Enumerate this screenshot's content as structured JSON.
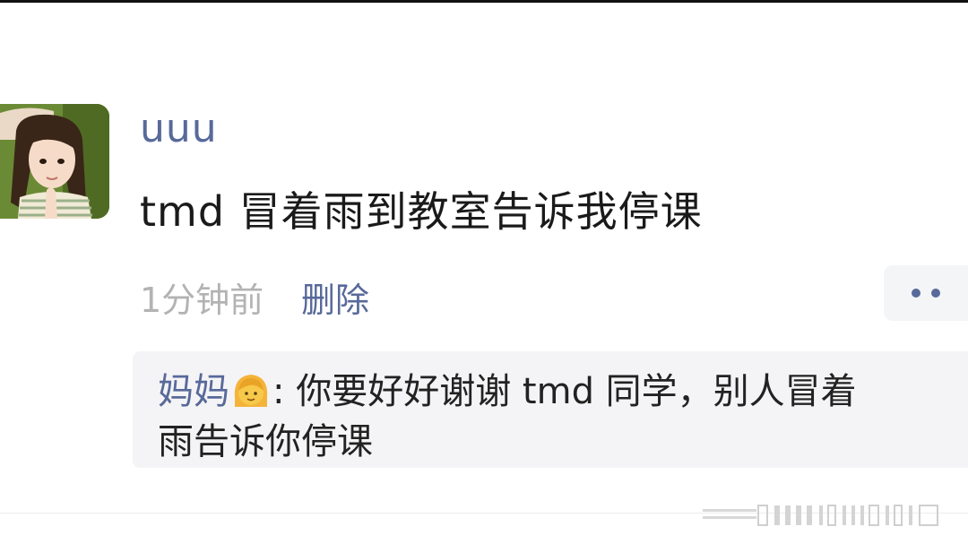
{
  "post": {
    "username": "uuu",
    "text": "tmd 冒着雨到教室告诉我停课",
    "timestamp": "1分钟前",
    "delete_label": "删除",
    "more_icon": "more-dots-icon"
  },
  "comment": {
    "author": "妈妈",
    "author_emoji": "woman-emoji-icon",
    "separator": ":",
    "text_line1": "你要好好谢谢 tmd 同学，别人冒着",
    "text_line2": "雨告诉你停课"
  },
  "colors": {
    "link": "#58699a",
    "timestamp": "#b3b3b3",
    "comment_bg": "#f4f4f6"
  }
}
